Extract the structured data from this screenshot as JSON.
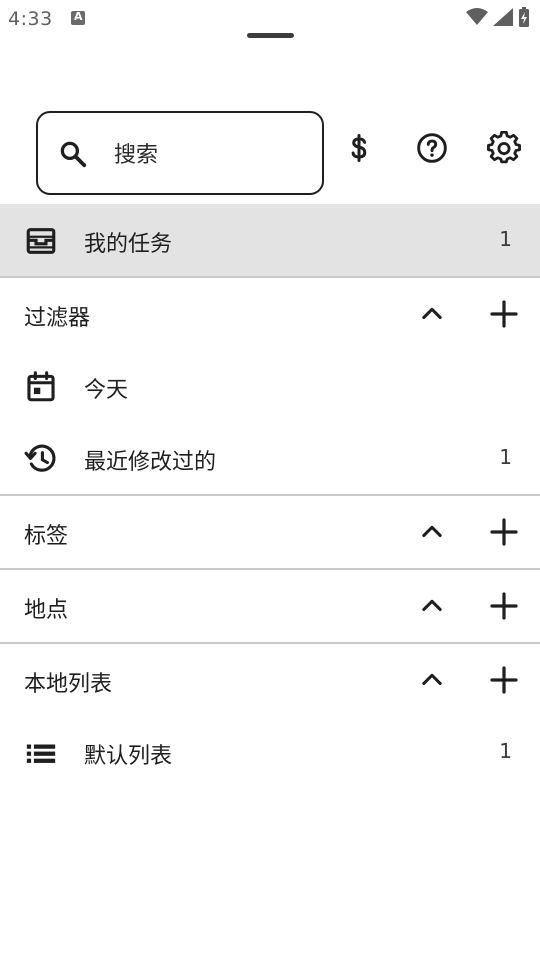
{
  "status_bar": {
    "time": "4:33",
    "icons": [
      "notification-a-icon",
      "wifi-icon",
      "signal-icon",
      "battery-icon"
    ]
  },
  "search": {
    "placeholder": "搜索"
  },
  "toolbar": {
    "icons": [
      "dollar-icon",
      "help-icon",
      "settings-icon"
    ]
  },
  "my_tasks": {
    "label": "我的任务",
    "count": "1"
  },
  "filters": {
    "title": "过滤器",
    "items": [
      {
        "label": "今天",
        "count": "",
        "icon": "calendar-icon"
      },
      {
        "label": "最近修改过的",
        "count": "1",
        "icon": "history-icon"
      }
    ]
  },
  "tags": {
    "title": "标签"
  },
  "places": {
    "title": "地点"
  },
  "local_lists": {
    "title": "本地列表",
    "items": [
      {
        "label": "默认列表",
        "count": "1",
        "icon": "list-icon"
      }
    ]
  },
  "colors": {
    "selected_row": "#e3e3e3",
    "divider": "#c9c9c9",
    "text": "#1f1f1f"
  }
}
